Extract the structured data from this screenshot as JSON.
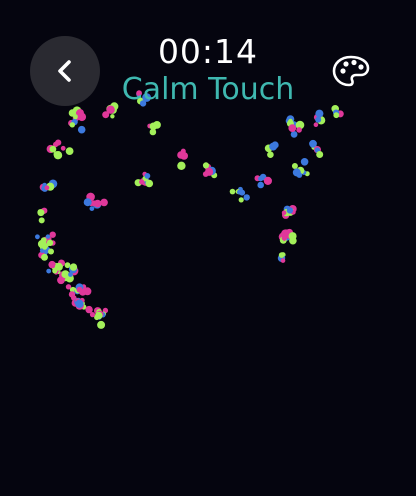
{
  "status_bar": {
    "time": "00:14"
  },
  "header": {
    "title": "Calm Touch",
    "back_icon": "chevron-left-icon",
    "palette_icon": "palette-icon"
  },
  "theme": {
    "background": "#05050f",
    "title_color": "#3fb8b0",
    "back_button_bg": "#2a2a31"
  },
  "particles": {
    "colors": [
      "#e0389a",
      "#3c79de",
      "#a3f05a"
    ]
  }
}
